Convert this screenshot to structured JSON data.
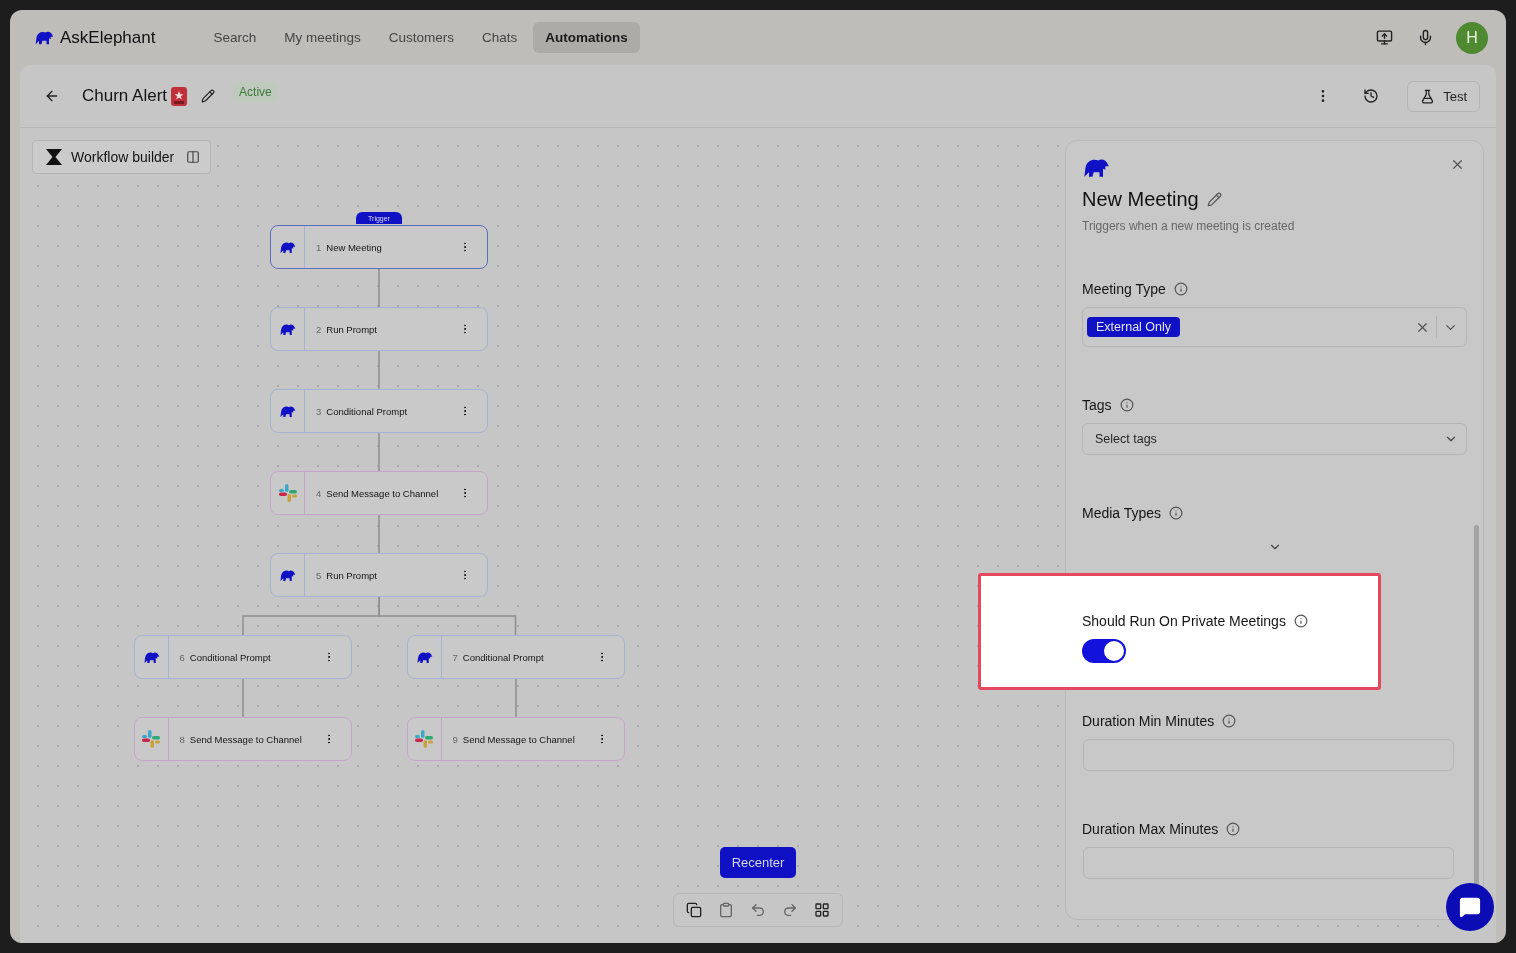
{
  "app": {
    "name": "AskElephant",
    "avatar": "H"
  },
  "nav": [
    {
      "label": "Search",
      "selected": false
    },
    {
      "label": "My meetings",
      "selected": false
    },
    {
      "label": "Customers",
      "selected": false
    },
    {
      "label": "Chats",
      "selected": false
    },
    {
      "label": "Automations",
      "selected": true
    }
  ],
  "header": {
    "title": "Churn Alert",
    "status": "Active",
    "test_button": "Test"
  },
  "workflow_builder": {
    "label": "Workflow builder"
  },
  "nodes": [
    {
      "number": "1",
      "label": "New Meeting",
      "kind": "elephant",
      "badge": "Trigger",
      "selected": true,
      "children": [
        {
          "number": "2",
          "label": "Run Prompt",
          "kind": "elephant",
          "selected": false,
          "children": [
            {
              "number": "3",
              "label": "Conditional Prompt",
              "kind": "elephant",
              "selected": false,
              "children": [
                {
                  "number": "4",
                  "label": "Send Message to Channel",
                  "kind": "slack",
                  "selected": false,
                  "children": [
                    {
                      "number": "5",
                      "label": "Run Prompt",
                      "kind": "elephant",
                      "selected": false,
                      "children": [
                        {
                          "number": "6",
                          "label": "Conditional Prompt",
                          "kind": "elephant",
                          "selected": false,
                          "children": [
                            {
                              "number": "8",
                              "label": "Send Message to Channel",
                              "kind": "slack",
                              "selected": false
                            }
                          ]
                        },
                        {
                          "number": "7",
                          "label": "Conditional Prompt",
                          "kind": "elephant",
                          "selected": false,
                          "children": [
                            {
                              "number": "9",
                              "label": "Send Message to Channel",
                              "kind": "slack",
                              "selected": false
                            }
                          ]
                        }
                      ]
                    }
                  ]
                }
              ]
            }
          ]
        }
      ]
    }
  ],
  "panel": {
    "title": "New Meeting",
    "description": "Triggers when a new meeting is created",
    "fields": [
      {
        "kind": "multiselect",
        "label": "Meeting Type",
        "chips": [
          "External Only"
        ]
      },
      {
        "kind": "select",
        "label": "Tags",
        "placeholder": "Select tags"
      },
      {
        "kind": "select-empty",
        "label": "Media Types"
      },
      {
        "kind": "toggle",
        "label": "Should Run On Private Meetings",
        "on": true,
        "highlighted": true
      },
      {
        "kind": "number",
        "label": "Duration Min Minutes"
      },
      {
        "kind": "number",
        "label": "Duration Max Minutes"
      }
    ]
  },
  "canvas_controls": {
    "recenter": "Recenter"
  }
}
